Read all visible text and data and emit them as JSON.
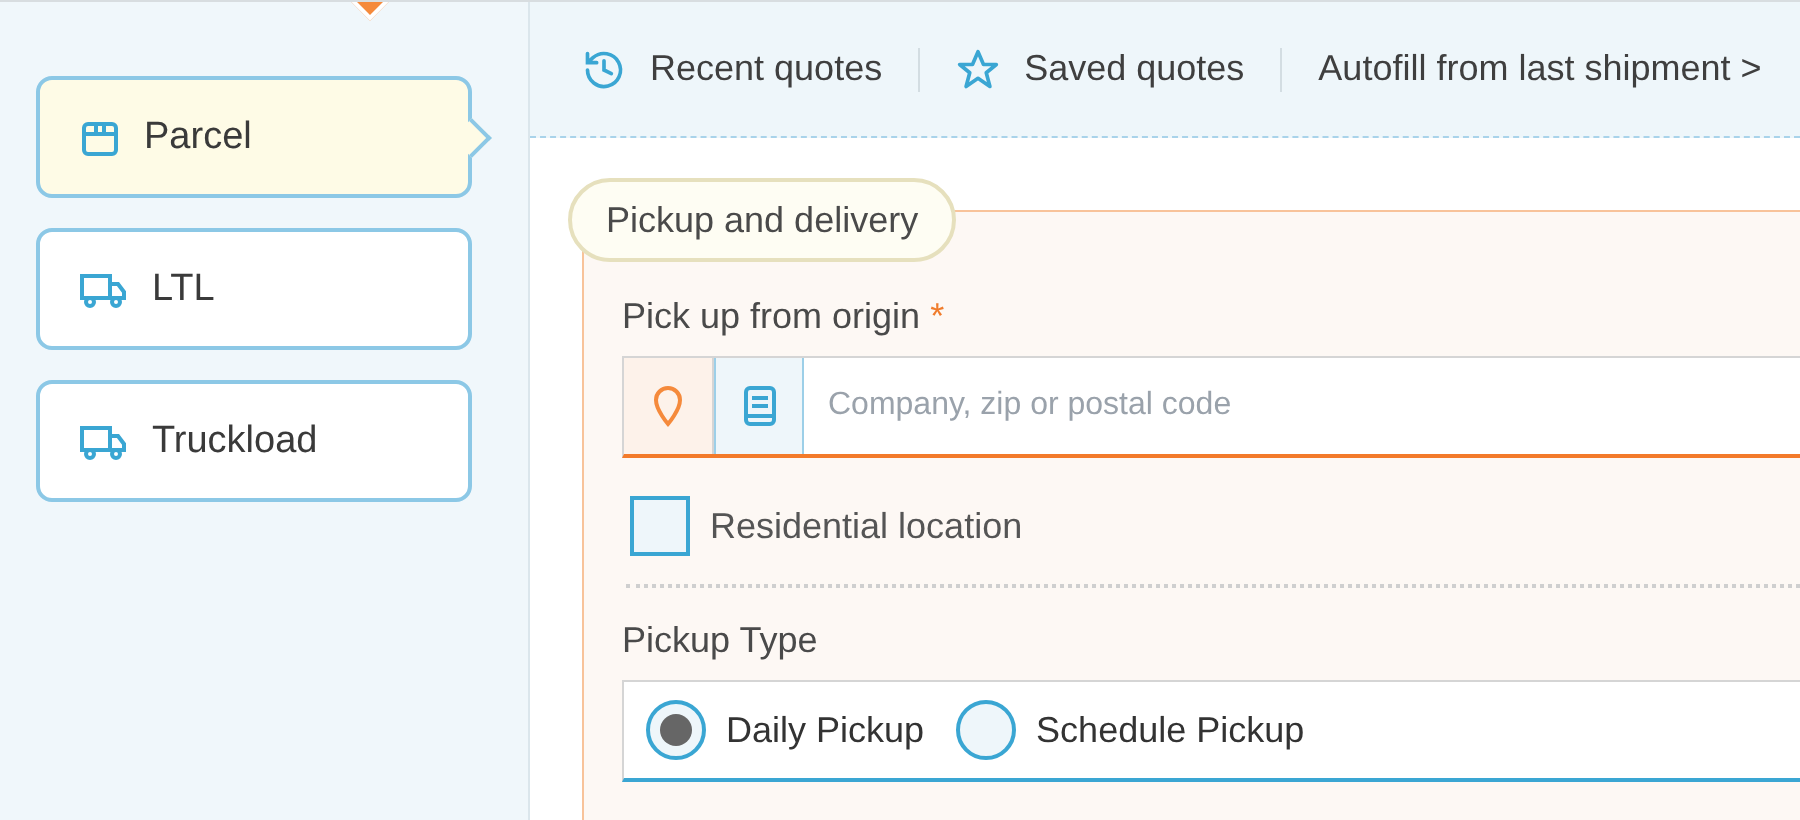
{
  "modes": [
    {
      "label": "Parcel",
      "kind": "parcel",
      "selected": true
    },
    {
      "label": "LTL",
      "kind": "truck",
      "selected": false
    },
    {
      "label": "Truckload",
      "kind": "truck",
      "selected": false
    }
  ],
  "toolbar": [
    {
      "label": "Recent quotes",
      "kind": "history"
    },
    {
      "label": "Saved quotes",
      "kind": "saved"
    },
    {
      "label": "Autofill from last shipment >",
      "kind": "plain"
    }
  ],
  "section": {
    "title": "Pickup and delivery",
    "origin": {
      "label": "Pick up from origin",
      "required_mark": "*",
      "placeholder": "Company, zip or postal code"
    },
    "residential": {
      "label": "Residential location",
      "checked": false
    },
    "pickup_type": {
      "label": "Pickup Type",
      "options": [
        {
          "label": "Daily Pickup",
          "selected": true
        },
        {
          "label": "Schedule Pickup",
          "selected": false
        }
      ]
    }
  }
}
